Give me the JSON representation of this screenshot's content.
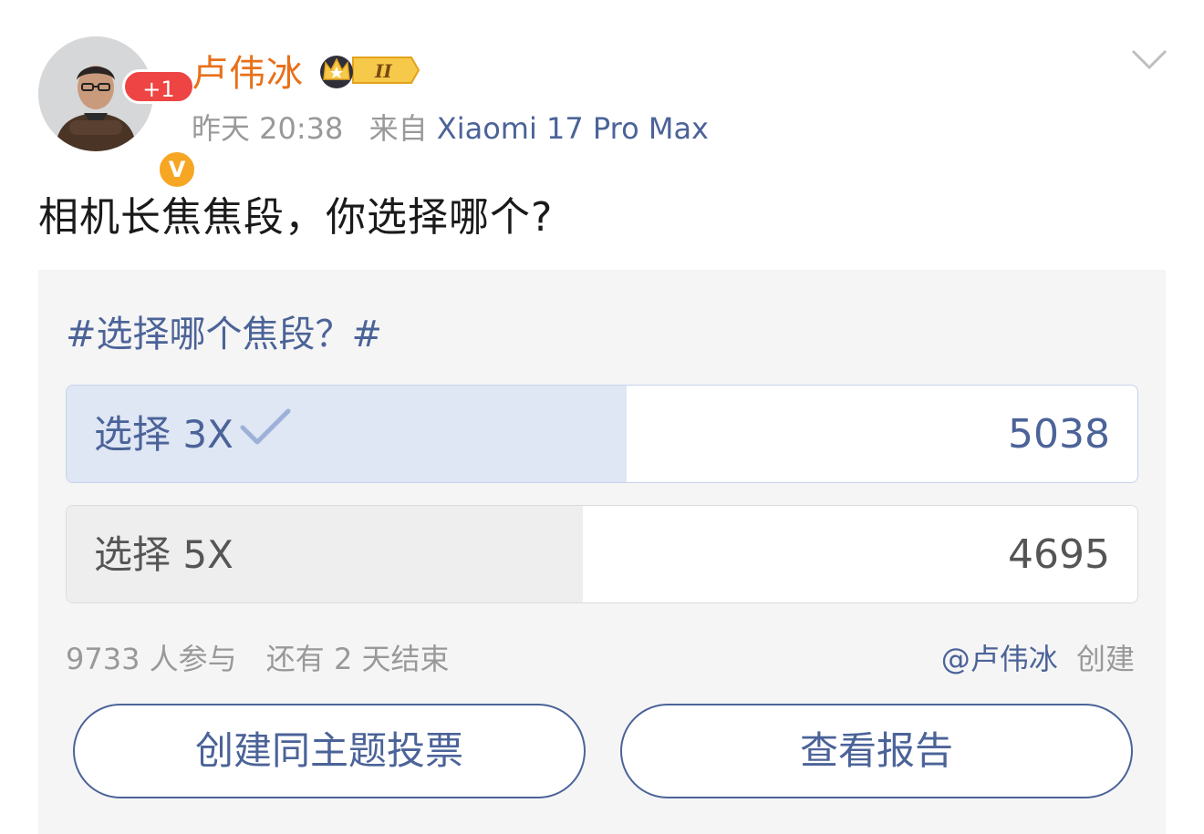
{
  "post": {
    "author_name": "卢伟冰",
    "notification_count": "+1",
    "verified_mark": "V",
    "crown_level": "II",
    "timestamp": "昨天 20:38",
    "source_prefix": "来自",
    "source_device": "Xiaomi 17 Pro Max",
    "text": "相机长焦焦段，你选择哪个?"
  },
  "poll": {
    "title": "#选择哪个焦段？#",
    "options": [
      {
        "label": "选择 3X",
        "votes": "5038",
        "fraction": 0.523,
        "selected": true
      },
      {
        "label": "选择 5X",
        "votes": "4695",
        "fraction": 0.482,
        "selected": false
      }
    ],
    "participants": "9733 人参与",
    "time_left": "还有 2 天结束",
    "creator": "@卢伟冰",
    "creator_suffix": "创建",
    "create_button": "创建同主题投票",
    "report_button": "查看报告"
  },
  "colors": {
    "author_name": "#e8701a",
    "link_blue": "#4b6398",
    "selected_fill": "#dfe6f4",
    "unselected_fill": "#eeeeee",
    "badge_red": "#ee4444",
    "verified_orange": "#f6a623"
  },
  "icons": {
    "chevron": "chevron-down-icon",
    "check": "check-icon",
    "crown": "crown-badge-icon",
    "verified": "verified-v-icon"
  }
}
